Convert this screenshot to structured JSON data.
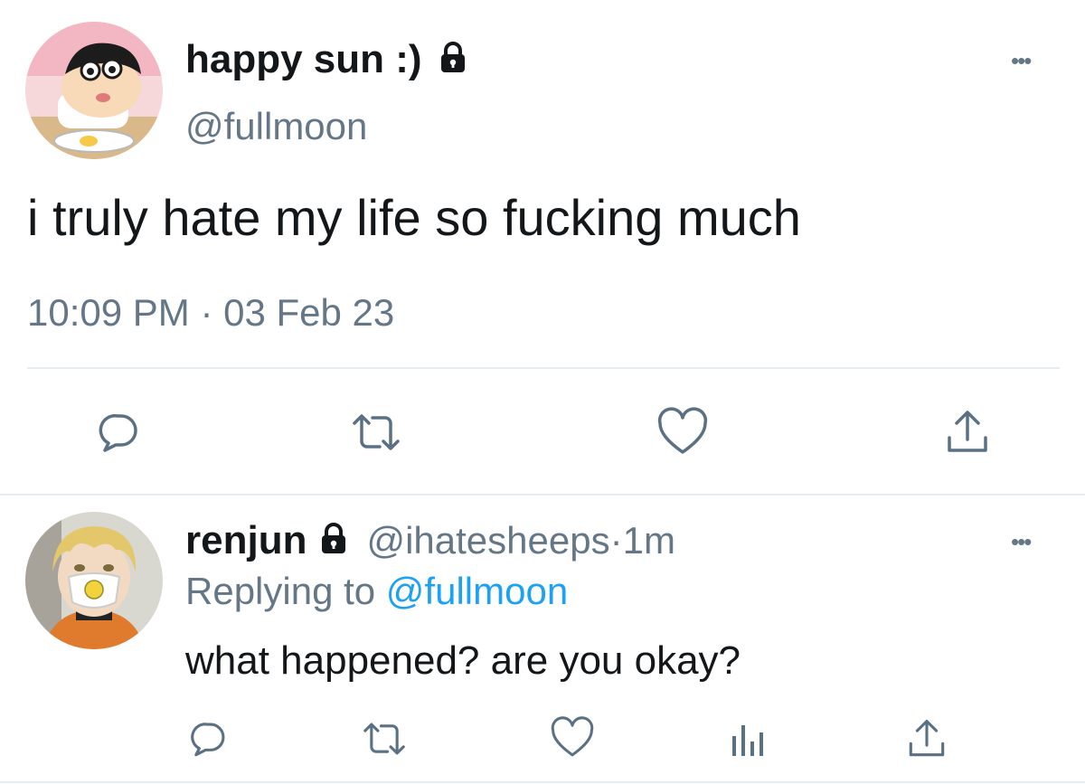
{
  "tweet": {
    "display_name": "happy sun :)",
    "handle": "@fullmoon",
    "text": "i truly hate my life so fucking much",
    "time": "10:09 PM",
    "separator": " · ",
    "date": "03 Feb 23",
    "more": "•••"
  },
  "reply": {
    "display_name": "renjun",
    "handle": "@ihatesheeps",
    "separator": " · ",
    "age": "1m",
    "replying_prefix": "Replying to ",
    "replying_handle": "@fullmoon",
    "text": "what happened? are you okay?",
    "more": "•••"
  },
  "colors": {
    "accent": "#1da1f2",
    "secondary_text": "#657786",
    "icon": "#5b7083",
    "divider": "#e6ecf0"
  },
  "icons": {
    "tweet_actions": [
      "reply-icon",
      "retweet-icon",
      "like-icon",
      "share-icon"
    ],
    "reply_actions": [
      "reply-icon",
      "retweet-icon",
      "like-icon",
      "analytics-icon",
      "share-icon"
    ],
    "lock": "lock-icon"
  }
}
